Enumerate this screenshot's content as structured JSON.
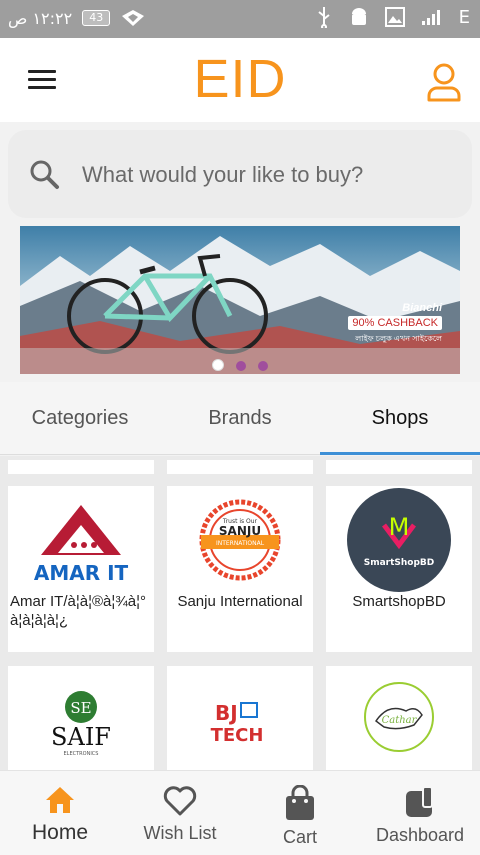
{
  "status": {
    "time": "١٢:٢٢ ص",
    "battery": "43",
    "network": "E"
  },
  "header": {
    "brand": "EID"
  },
  "search": {
    "placeholder": "What would your like to buy?"
  },
  "banner": {
    "brand": "Bianchi",
    "offer_pct": "90%",
    "offer_text": "CASHBACK",
    "tagline": "লাইফ চলুক এখন সাইকেলে"
  },
  "tabs": [
    {
      "label": "Categories"
    },
    {
      "label": "Brands"
    },
    {
      "label": "Shops"
    }
  ],
  "shops": [
    {
      "name": "Amar IT/à¦à¦®à¦¾à¦°",
      "name2": "à¦à¦à¦à¦¿",
      "logo_text": "AMAR IT"
    },
    {
      "name": "Sanju International",
      "logo_text": "SANJU",
      "logo_sub": "INTERNATIONAL",
      "logo_top": "Trust is Our"
    },
    {
      "name": "SmartshopBD",
      "logo_text": "SmartShopBD"
    },
    {
      "name": "",
      "logo_text": "SAIF",
      "logo_sub": "ELECTRONICS"
    },
    {
      "name": "",
      "logo_text": "TECH",
      "logo_prefix": "BJ"
    },
    {
      "name": "",
      "logo_text": "Cathar"
    }
  ],
  "bottom_nav": [
    {
      "label": "Home"
    },
    {
      "label": "Wish List"
    },
    {
      "label": "Cart"
    },
    {
      "label": "Dashboard"
    }
  ],
  "colors": {
    "accent": "#f7941d",
    "tab_indicator": "#3d8fd6"
  }
}
